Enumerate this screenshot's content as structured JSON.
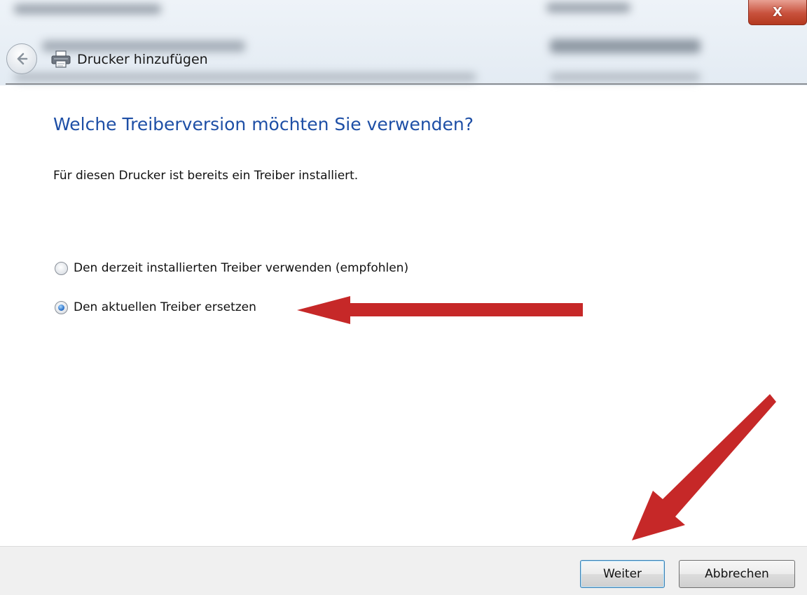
{
  "window": {
    "title": "Drucker hinzufügen",
    "close_label": "X"
  },
  "dialog": {
    "heading": "Welche Treiberversion möchten Sie verwenden?",
    "intro": "Für diesen Drucker ist bereits ein Treiber installiert.",
    "options": [
      {
        "label": "Den derzeit installierten Treiber verwenden (empfohlen)",
        "selected": false
      },
      {
        "label": "Den aktuellen Treiber ersetzen",
        "selected": true
      }
    ]
  },
  "buttons": {
    "next_label": "Weiter",
    "cancel_label": "Abbrechen"
  },
  "icons": {
    "back": "back-arrow-icon",
    "printer": "printer-icon",
    "close": "close-icon"
  },
  "colors": {
    "heading": "#1e4fa6",
    "annotation_arrow": "#c62828",
    "close_button": "#c8513c"
  }
}
